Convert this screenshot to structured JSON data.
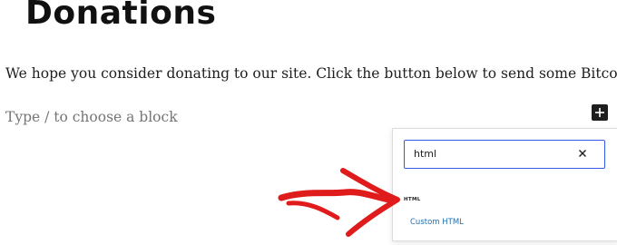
{
  "page": {
    "title": "Donations",
    "paragraph": "We hope you consider donating to our site. Click the button below to send some Bitcoin:",
    "block_placeholder": "Type / to choose a block"
  },
  "inserter": {
    "search_value": "html",
    "results": [
      {
        "icon_text": "HTML",
        "label": "Custom HTML"
      }
    ]
  },
  "icons": {
    "add_block": "plus-icon",
    "clear_search": "close-icon",
    "annotation": "red-arrow-icon"
  },
  "colors": {
    "accent": "#3858e9",
    "link": "#2271b1",
    "annotation": "#e01b1b",
    "button_dark": "#1e1e1e"
  }
}
